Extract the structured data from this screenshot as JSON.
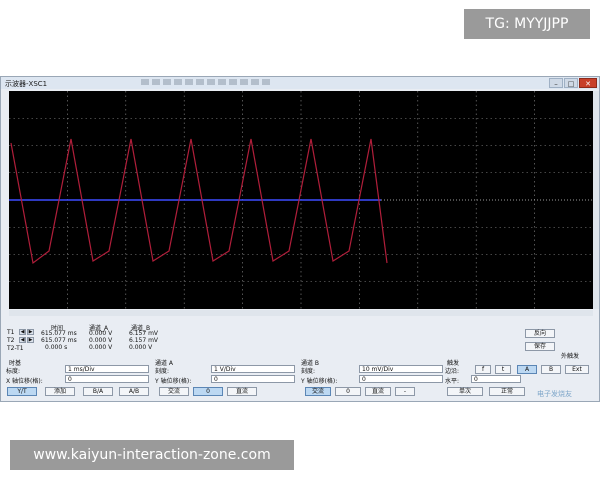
{
  "overlays": {
    "tg": "TG: MYYJJPP",
    "url": "www.kaiyun-interaction-zone.com"
  },
  "window": {
    "title": "示波器-XSC1",
    "close": "✕",
    "minimize": "–",
    "maximize": "□"
  },
  "cursor_table": {
    "headers": [
      "时间",
      "通道_A",
      "通道_B"
    ],
    "rows": [
      {
        "label": "T1",
        "time": "615.077 ms",
        "a": "0.000 V",
        "b": "6.157 mV"
      },
      {
        "label": "T2",
        "time": "615.077 ms",
        "a": "0.000 V",
        "b": "6.157 mV"
      },
      {
        "label": "T2-T1",
        "time": "0.000 s",
        "a": "0.000 V",
        "b": "0.000 V"
      }
    ]
  },
  "right_buttons": {
    "reverse": "反向",
    "save": "保存",
    "ext_trigger": "外触发"
  },
  "timebase": {
    "header": "时基",
    "scale_label": "标度:",
    "scale_value": "1 ms/Div",
    "xpos_label": "X 轴位移(格):",
    "xpos_value": "0",
    "modes": [
      "Y/T",
      "添加",
      "B/A",
      "A/B"
    ]
  },
  "channel_a": {
    "header": "通道 A",
    "scale_label": "刻度:",
    "scale_value": "1 V/Div",
    "ypos_label": "Y 轴位移(格):",
    "ypos_value": "0",
    "coupling": [
      "交流",
      "0",
      "直流"
    ]
  },
  "channel_b": {
    "header": "通道 B",
    "scale_label": "刻度:",
    "scale_value": "10 mV/Div",
    "ypos_label": "Y 轴位移(格):",
    "ypos_value": "0",
    "coupling": [
      "交流",
      "0",
      "直流",
      "-"
    ]
  },
  "trigger": {
    "header": "触发",
    "edge_label": "边沿:",
    "edge_buttons": [
      "f",
      "t",
      "A",
      "B",
      "Ext"
    ],
    "level_label": "水平:",
    "level_value": "0",
    "modes": [
      "单次",
      "正常"
    ]
  },
  "colors": {
    "screen_bg": "#000000",
    "grid": "#8a8a8a",
    "trace_a": "#b01e3a",
    "trace_b": "#3d4cff"
  },
  "watermark": "电子发烧友"
}
